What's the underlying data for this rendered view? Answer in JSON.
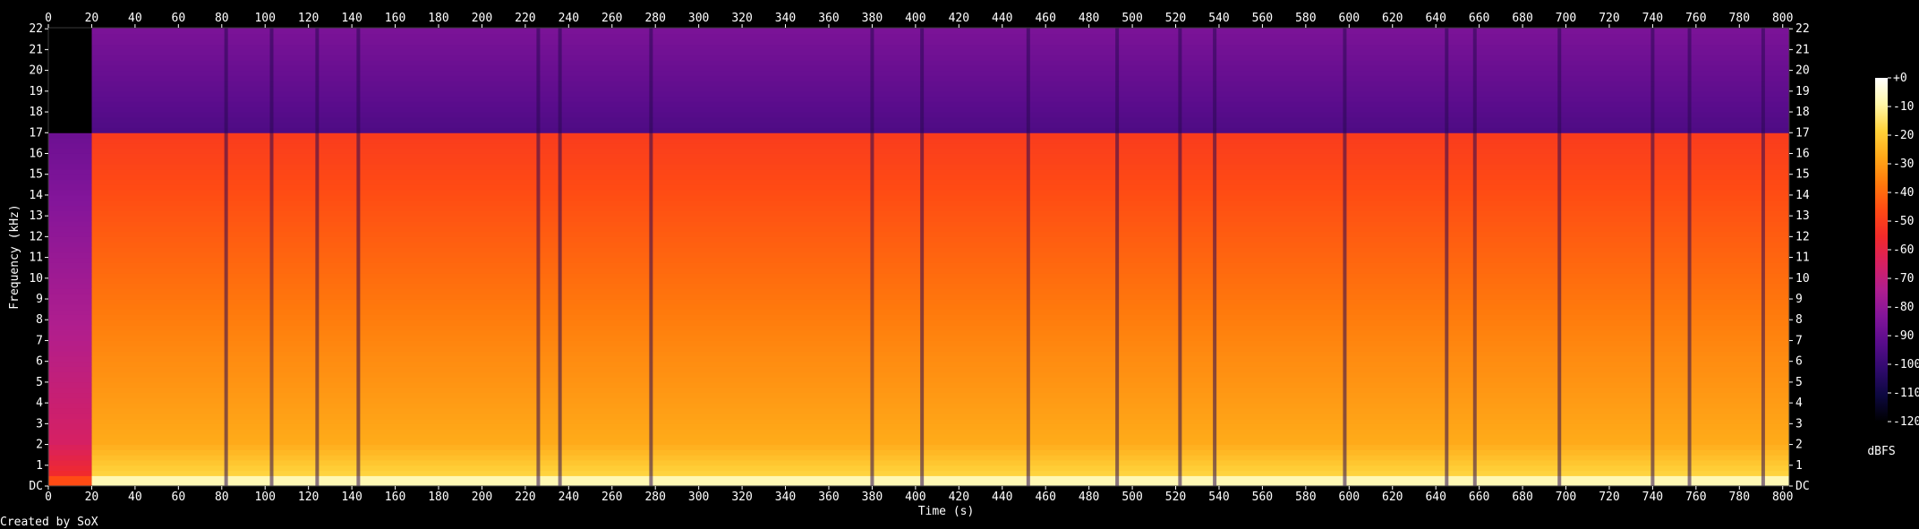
{
  "chart_data": {
    "type": "heatmap",
    "credit": "Created by SoX",
    "x_axis": {
      "label": "Time (s)",
      "range": [
        0,
        803
      ],
      "tick_values": [
        0,
        20,
        40,
        60,
        80,
        100,
        120,
        140,
        160,
        180,
        200,
        220,
        240,
        260,
        280,
        300,
        320,
        340,
        360,
        380,
        400,
        420,
        440,
        460,
        480,
        500,
        520,
        540,
        560,
        580,
        600,
        620,
        640,
        660,
        680,
        700,
        720,
        740,
        760,
        780,
        800
      ]
    },
    "y_axis": {
      "label": "Frequency (kHz)",
      "range": [
        0,
        22.05
      ],
      "tick_values": [
        0,
        1,
        2,
        3,
        4,
        5,
        6,
        7,
        8,
        9,
        10,
        11,
        12,
        13,
        14,
        15,
        16,
        17,
        18,
        19,
        20,
        21,
        22
      ],
      "tick_labels": [
        "DC",
        "1",
        "2",
        "3",
        "4",
        "5",
        "6",
        "7",
        "8",
        "9",
        "10",
        "11",
        "12",
        "13",
        "14",
        "15",
        "16",
        "17",
        "18",
        "19",
        "20",
        "21",
        "22"
      ]
    },
    "colorbar": {
      "label": "dBFS",
      "range": [
        -120,
        0
      ],
      "tick_values": [
        0,
        -10,
        -20,
        -30,
        -40,
        -50,
        -60,
        -70,
        -80,
        -90,
        -100,
        -110,
        -120
      ],
      "tick_labels": [
        "+0",
        "-10",
        "-20",
        "-30",
        "-40",
        "-50",
        "-60",
        "-70",
        "-80",
        "-90",
        "-100",
        "-110",
        "-120"
      ],
      "colormap": [
        "#000000",
        "#0d0840",
        "#300a6e",
        "#5a0c8c",
        "#84159a",
        "#b01e8e",
        "#d82060",
        "#f22a2a",
        "#ff4a14",
        "#ff7a0c",
        "#ffa818",
        "#ffd23a",
        "#fff7a8",
        "#ffffff"
      ]
    },
    "content": {
      "lowpass_cutoff_khz": 17.0,
      "fade_in_end_s": 20,
      "gaps_s": [
        82,
        103,
        124,
        143,
        226,
        236,
        278,
        380,
        403,
        452,
        493,
        522,
        538,
        598,
        645,
        658,
        697,
        740,
        757,
        791
      ]
    }
  }
}
